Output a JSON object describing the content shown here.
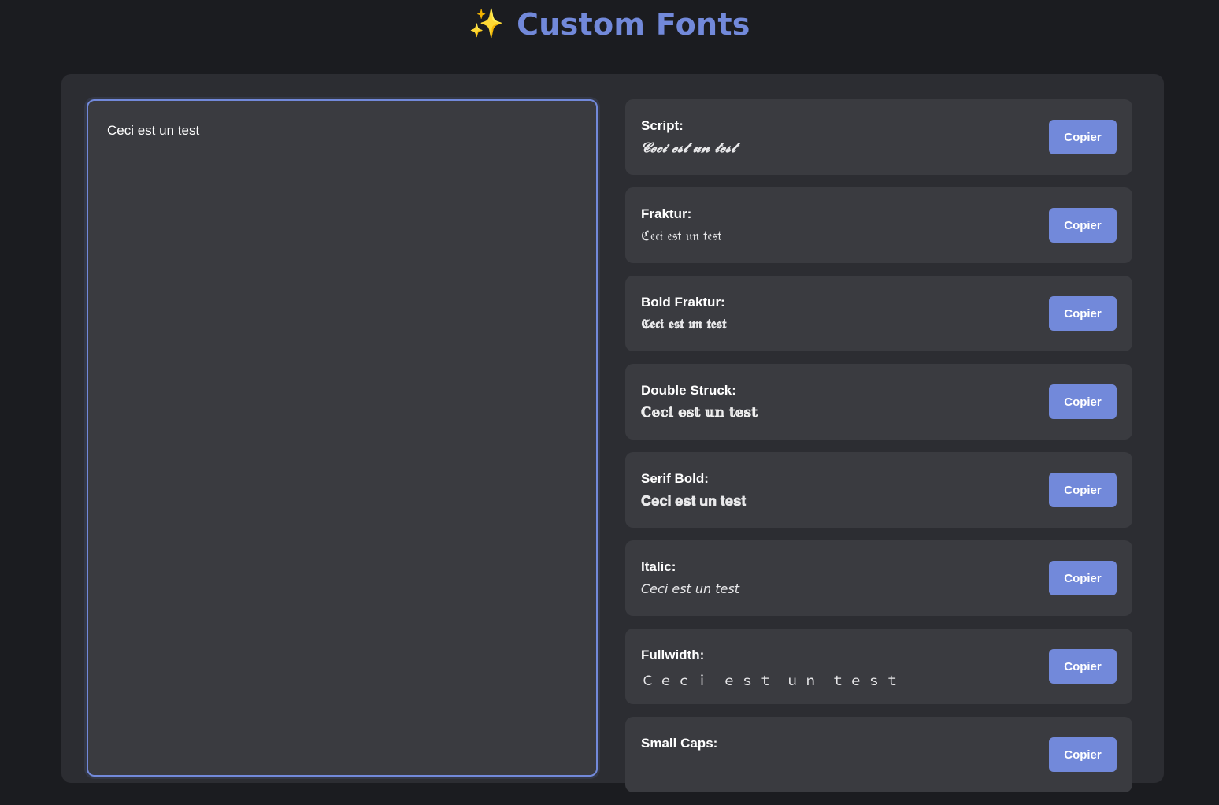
{
  "header": {
    "icon": "sparkles-icon",
    "icon_glyph": "✨",
    "title": "Custom Fonts",
    "title_color": "#7289da"
  },
  "editor": {
    "value": "Ceci est un test"
  },
  "results": [
    {
      "label": "Script:",
      "value": "𝓒𝓮𝓬𝓲 𝓮𝓼𝓽 𝓾𝓷 𝓽𝓮𝓼𝓽",
      "style": "script",
      "button": "Copier"
    },
    {
      "label": "Fraktur:",
      "value": "ℭ𝔢𝔠𝔦 𝔢𝔰𝔱 𝔲𝔫 𝔱𝔢𝔰𝔱",
      "style": "fraktur",
      "button": "Copier"
    },
    {
      "label": "Bold Fraktur:",
      "value": "𝕮𝖊𝖈𝖎 𝖊𝖘𝖙 𝖚𝖓 𝖙𝖊𝖘𝖙",
      "style": "bold-fraktur",
      "button": "Copier"
    },
    {
      "label": "Double Struck:",
      "value": "ℂ𝕖𝕔𝕚 𝕖𝕤𝕥 𝕦𝕟 𝕥𝕖𝕤𝕥",
      "style": "double",
      "button": "Copier"
    },
    {
      "label": "Serif Bold:",
      "value": "𝐂𝐞𝐜𝐢 𝐞𝐬𝐭 𝐮𝐧 𝐭𝐞𝐬𝐭",
      "style": "serif-bold",
      "button": "Copier"
    },
    {
      "label": "Italic:",
      "value": "𝘊𝘦𝘤𝘪 𝘦𝘴𝘵 𝘶𝘯 𝘵𝘦𝘴𝘵",
      "style": "italic",
      "button": "Copier"
    },
    {
      "label": "Fullwidth:",
      "value": "Ｃｅｃｉ ｅｓｔ ｕｎ ｔｅｓｔ",
      "style": "fullwidth",
      "button": "Copier"
    },
    {
      "label": "Small Caps:",
      "value": "",
      "style": "smallcaps",
      "button": "Copier"
    }
  ],
  "colors": {
    "background": "#1b1c20",
    "panel": "#2c2d32",
    "card": "#3a3b40",
    "accent": "#7289da"
  }
}
